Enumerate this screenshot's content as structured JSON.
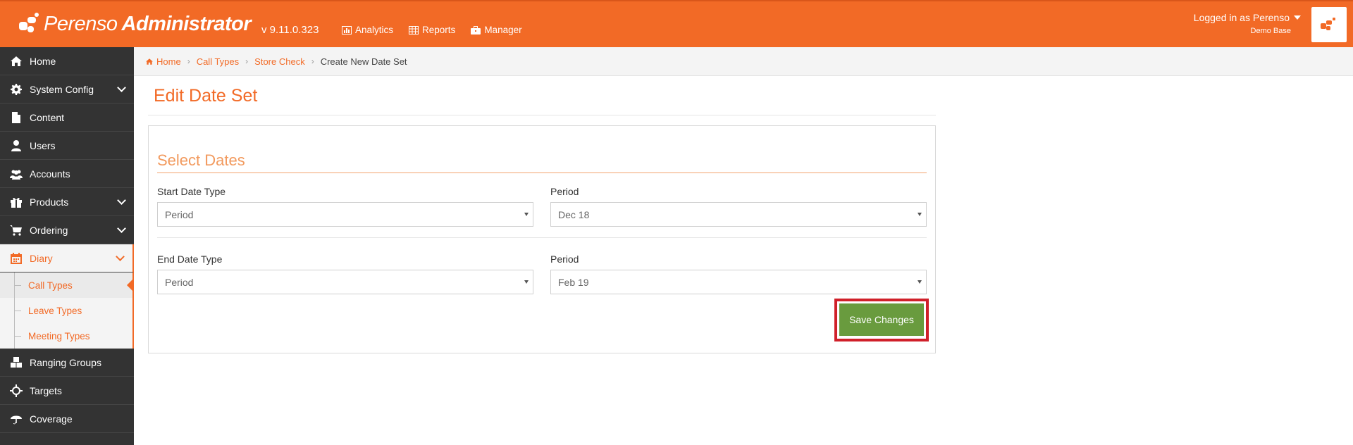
{
  "header": {
    "brand_light": "Perenso",
    "brand_bold": "Administrator",
    "version": "v 9.11.0.323",
    "nav": [
      {
        "label": "Analytics",
        "icon": "chart-icon"
      },
      {
        "label": "Reports",
        "icon": "table-icon"
      },
      {
        "label": "Manager",
        "icon": "briefcase-icon"
      }
    ],
    "user_label": "Logged in as Perenso",
    "user_sub": "Demo Base"
  },
  "sidebar": {
    "items": [
      {
        "label": "Home",
        "icon": "home-icon"
      },
      {
        "label": "System Config",
        "icon": "gear-icon"
      },
      {
        "label": "Content",
        "icon": "file-icon"
      },
      {
        "label": "Users",
        "icon": "user-icon"
      },
      {
        "label": "Accounts",
        "icon": "users-icon"
      },
      {
        "label": "Products",
        "icon": "gift-icon"
      },
      {
        "label": "Ordering",
        "icon": "cart-icon"
      },
      {
        "label": "Diary",
        "icon": "calendar-icon"
      },
      {
        "label": "Ranging Groups",
        "icon": "cubes-icon"
      },
      {
        "label": "Targets",
        "icon": "crosshairs-icon"
      },
      {
        "label": "Coverage",
        "icon": "umbrella-icon"
      }
    ],
    "diary_sub": [
      {
        "label": "Call Types"
      },
      {
        "label": "Leave Types"
      },
      {
        "label": "Meeting Types"
      }
    ]
  },
  "breadcrumb": [
    "Home",
    "Call Types",
    "Store Check",
    "Create New Date Set"
  ],
  "main": {
    "title": "Edit Date Set",
    "section_title": "Select Dates",
    "start_type_label": "Start Date Type",
    "start_type_value": "Period",
    "start_period_label": "Period",
    "start_period_value": "Dec 18",
    "end_type_label": "End Date Type",
    "end_type_value": "Period",
    "end_period_label": "Period",
    "end_period_value": "Feb 19",
    "save_label": "Save Changes"
  },
  "colors": {
    "brand_orange": "#f26a26",
    "sidebar_bg": "#333333",
    "save_green": "#699b3e",
    "highlight_red": "#d0202a"
  }
}
